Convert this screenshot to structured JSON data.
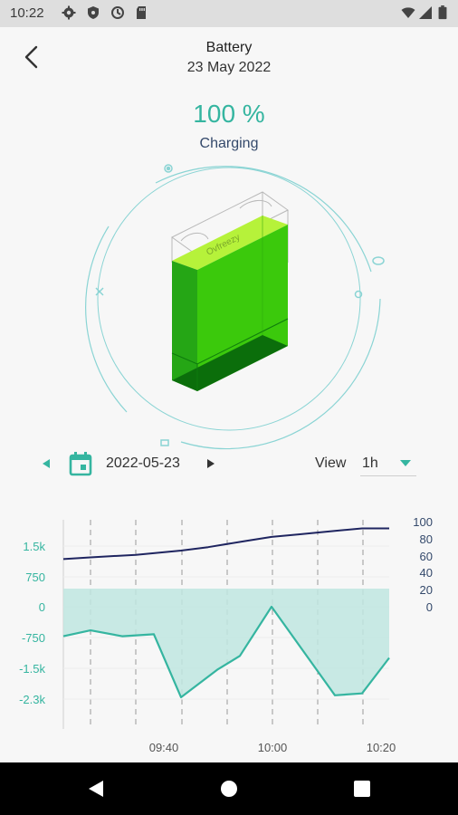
{
  "status_bar": {
    "time": "10:22",
    "left_icons": [
      "settings-icon",
      "shield-icon",
      "data-saver-icon",
      "sd-card-icon"
    ],
    "right_icons": [
      "wifi-icon",
      "cellular-signal-icon",
      "battery-icon"
    ]
  },
  "header": {
    "title": "Battery",
    "date": "23 May 2022",
    "back_icon": "chevron-left-icon"
  },
  "battery": {
    "percent_label": "100 %",
    "level": 100,
    "status": "Charging",
    "brand_text": "Ovfreezy",
    "fill_color": "#37c70a",
    "ring_color": "#7fd3d3"
  },
  "date_nav": {
    "date": "2022-05-23",
    "view_label": "View",
    "view_value": "1h",
    "accent_color": "#35b5a0"
  },
  "chart_data": {
    "type": "line",
    "x_ticks": [
      "09:40",
      "10:00",
      "10:20"
    ],
    "left_axis": {
      "ticks": [
        "1.5k",
        "750",
        "0",
        "-750",
        "-1.5k",
        "-2.3k"
      ],
      "range": [
        -2300,
        1500
      ],
      "color": "#35b5a0"
    },
    "right_axis": {
      "ticks": [
        "100",
        "80",
        "60",
        "40",
        "20",
        "0"
      ],
      "range": [
        0,
        100
      ],
      "color": "#34496b"
    },
    "series": [
      {
        "axis": "right",
        "color": "#1f2560",
        "x": [
          "09:14",
          "09:20",
          "09:30",
          "09:40",
          "09:46",
          "09:54",
          "10:00",
          "10:06",
          "10:14",
          "10:20",
          "10:26"
        ],
        "values": [
          56,
          58,
          61,
          66,
          70,
          77,
          82,
          85,
          89,
          92,
          92
        ]
      },
      {
        "axis": "left",
        "color": "#35b5a0",
        "fill": true,
        "x": [
          "09:14",
          "09:20",
          "09:27",
          "09:34",
          "09:40",
          "09:48",
          "09:53",
          "10:00",
          "10:14",
          "10:20",
          "10:26"
        ],
        "values": [
          -750,
          -600,
          -750,
          -700,
          -2300,
          -1600,
          -1250,
          0,
          -2250,
          -2200,
          -1300
        ]
      }
    ],
    "grid": "vertical-dashed"
  },
  "nav_bar": {
    "icons": [
      "back-triangle-icon",
      "home-circle-icon",
      "recents-square-icon"
    ]
  }
}
